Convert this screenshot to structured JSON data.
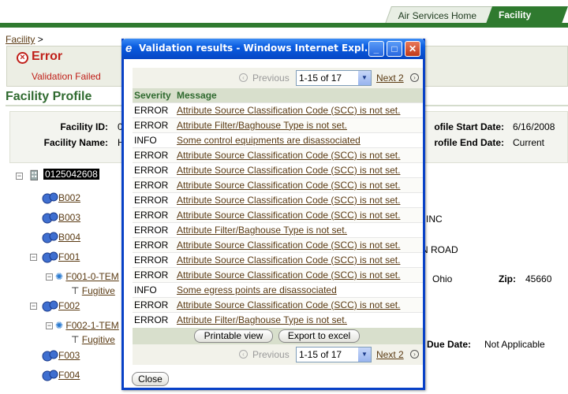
{
  "tabs": {
    "home": "Air Services Home",
    "facility": "Facility"
  },
  "breadcrumb": {
    "link": "Facility",
    "sep": ">"
  },
  "error": {
    "title": "Error",
    "message": "Validation Failed"
  },
  "section_title": "Facility Profile",
  "facility": {
    "id_label": "Facility ID:",
    "id_value": "0",
    "name_label": "Facility Name:",
    "name_value": "H",
    "start_label": "ofile Start Date:",
    "start_value": "6/16/2008",
    "end_label": "rofile End Date:",
    "end_value": "Current"
  },
  "right_info": {
    "inc": "INC",
    "road": "N ROAD",
    "state": "Ohio",
    "zip_label": "Zip:",
    "zip_value": "45660",
    "due_label": "Due Date:",
    "due_value": "Not Applicable"
  },
  "tree": {
    "root": "0125042608",
    "items": [
      "B002",
      "B003",
      "B004",
      "F001",
      "F001-0-TEM",
      "Fugitive",
      "F002",
      "F002-1-TEM",
      "Fugitive",
      "F003",
      "F004"
    ]
  },
  "popup": {
    "title": "Validation results - Windows Internet Expl...",
    "pager": {
      "previous": "Previous",
      "range": "1-15 of 17",
      "next": "Next 2"
    },
    "headers": {
      "severity": "Severity",
      "message": "Message"
    },
    "rows": [
      {
        "severity": "ERROR",
        "message": "Attribute Source Classification Code (SCC) is not set."
      },
      {
        "severity": "ERROR",
        "message": "Attribute Filter/Baghouse Type is not set."
      },
      {
        "severity": "INFO",
        "message": "Some control equipments are disassociated"
      },
      {
        "severity": "ERROR",
        "message": "Attribute Source Classification Code (SCC) is not set."
      },
      {
        "severity": "ERROR",
        "message": "Attribute Source Classification Code (SCC) is not set."
      },
      {
        "severity": "ERROR",
        "message": "Attribute Source Classification Code (SCC) is not set."
      },
      {
        "severity": "ERROR",
        "message": "Attribute Source Classification Code (SCC) is not set."
      },
      {
        "severity": "ERROR",
        "message": "Attribute Source Classification Code (SCC) is not set."
      },
      {
        "severity": "ERROR",
        "message": "Attribute Filter/Baghouse Type is not set."
      },
      {
        "severity": "ERROR",
        "message": "Attribute Source Classification Code (SCC) is not set."
      },
      {
        "severity": "ERROR",
        "message": "Attribute Source Classification Code (SCC) is not set."
      },
      {
        "severity": "ERROR",
        "message": "Attribute Source Classification Code (SCC) is not set."
      },
      {
        "severity": "INFO",
        "message": "Some egress points are disassociated"
      },
      {
        "severity": "ERROR",
        "message": "Attribute Source Classification Code (SCC) is not set."
      },
      {
        "severity": "ERROR",
        "message": "Attribute Filter/Baghouse Type is not set."
      }
    ],
    "buttons": {
      "print": "Printable view",
      "export": "Export to excel",
      "close": "Close"
    }
  },
  "colors": {
    "green": "#2f7a2f",
    "error_red": "#c0201a",
    "link_brown": "#5a3a12",
    "title_blue": "#0a5ce0"
  }
}
